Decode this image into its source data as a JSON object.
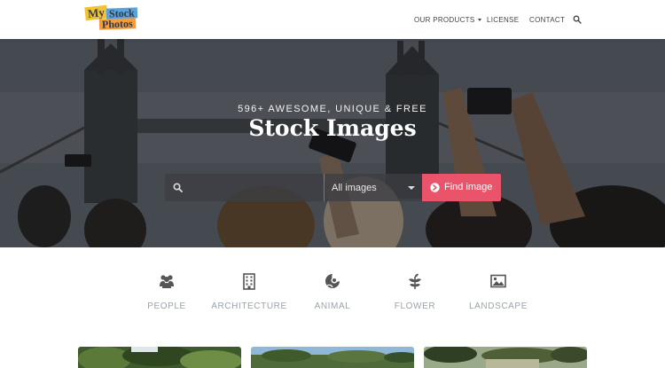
{
  "header": {
    "logo": {
      "line1": "My",
      "line2": "Stock",
      "line3": "Photos"
    },
    "nav": [
      {
        "label": "OUR PRODUCTS",
        "has_dropdown": true
      },
      {
        "label": "LICENSE",
        "has_dropdown": false
      },
      {
        "label": "CONTACT",
        "has_dropdown": false
      }
    ],
    "search_icon": "search-icon"
  },
  "hero": {
    "subtitle": "596+ AWESOME, UNIQUE & FREE",
    "title": "Stock Images",
    "search": {
      "placeholder": "",
      "value": "",
      "icon": "search-icon"
    },
    "select": {
      "selected": "All images",
      "icon": "caret-down-icon"
    },
    "button": {
      "label": "Find image",
      "icon": "arrow-circle-right-icon",
      "color": "#e9546b"
    }
  },
  "categories": [
    {
      "label": "PEOPLE",
      "icon": "people-icon"
    },
    {
      "label": "ARCHITECTURE",
      "icon": "building-icon"
    },
    {
      "label": "ANIMAL",
      "icon": "animal-icon"
    },
    {
      "label": "FLOWER",
      "icon": "leaf-icon"
    },
    {
      "label": "LANDSCAPE",
      "icon": "landscape-image-icon"
    }
  ],
  "colors": {
    "accent": "#e9546b",
    "category_text": "#9aa3ad",
    "category_icon": "#555555"
  }
}
